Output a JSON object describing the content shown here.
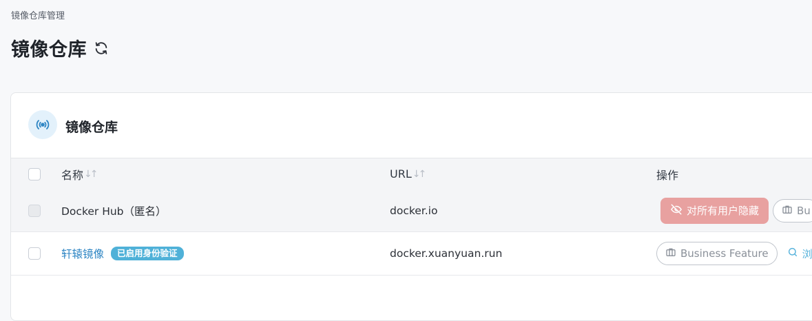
{
  "breadcrumb": "镜像仓库管理",
  "page": {
    "title": "镜像仓库"
  },
  "card": {
    "title": "镜像仓库"
  },
  "table": {
    "columns": {
      "name": "名称",
      "url": "URL",
      "ops": "操作"
    },
    "sort_indicator": "↓↑",
    "rows": [
      {
        "name": "Docker Hub（匿名）",
        "url": "docker.io",
        "actions": {
          "hide": "对所有用户隐藏",
          "business": "Bu"
        }
      },
      {
        "name": "轩辕镜像",
        "badge": "已启用身份验证",
        "url": "docker.xuanyuan.run",
        "actions": {
          "business": "Business Feature",
          "search": "浏"
        }
      }
    ]
  },
  "colors": {
    "accent_link": "#2f86c4",
    "badge": "#4fb1d8",
    "hide_button": "#e8a1a0",
    "card_icon_bg": "#e3f1fb"
  },
  "icons": {
    "title": "refresh-icon",
    "card": "broadcast-icon",
    "hide": "eye-off-icon",
    "business": "briefcase-icon",
    "search": "search-icon"
  }
}
